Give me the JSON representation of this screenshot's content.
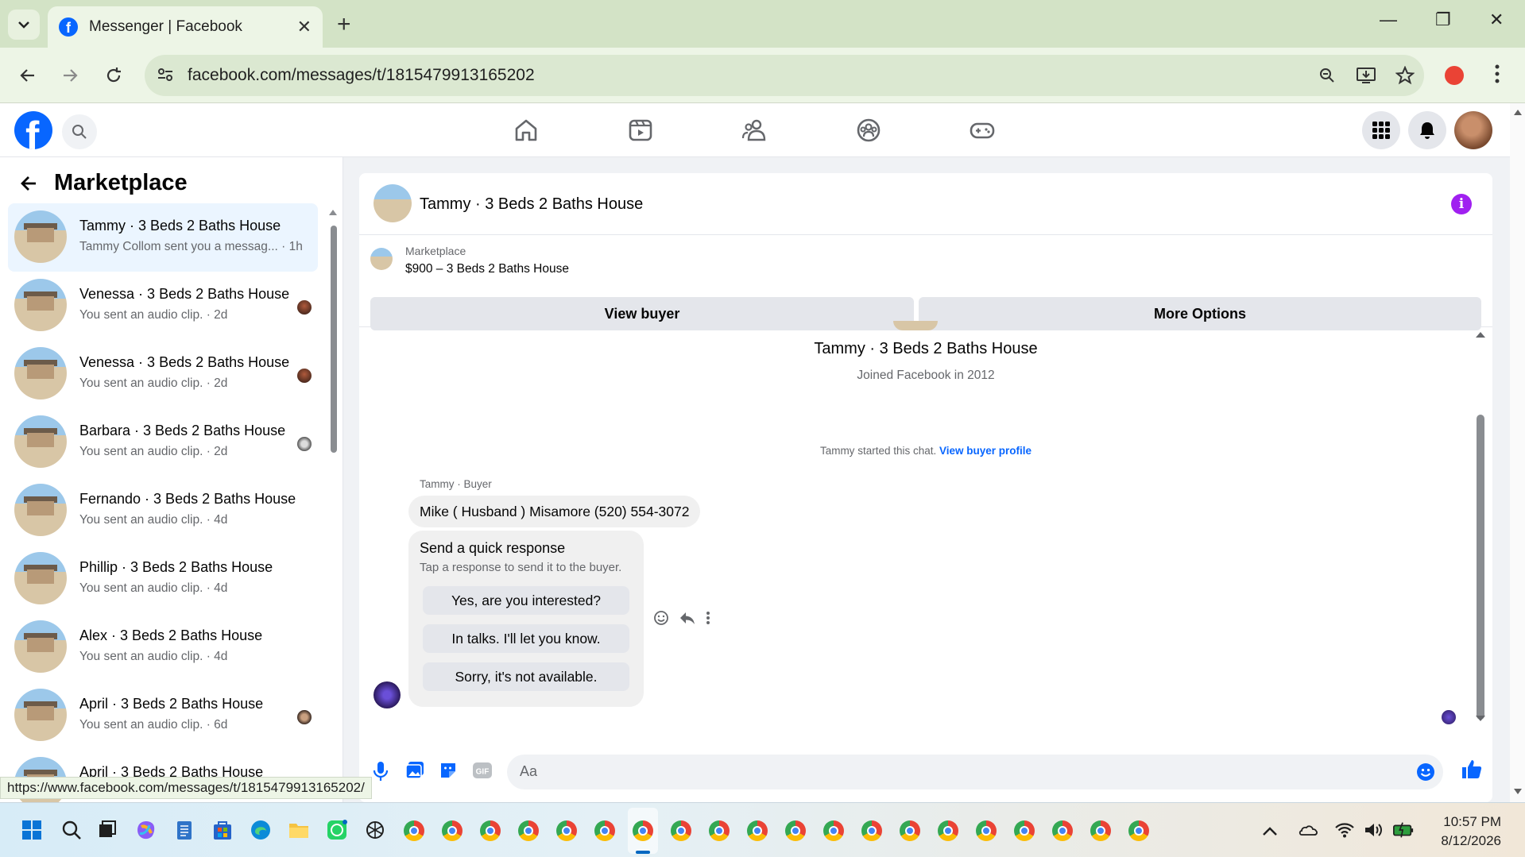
{
  "browser": {
    "tab_title": "Messenger | Facebook",
    "url": "facebook.com/messages/t/1815479913165202",
    "status_url": "https://www.facebook.com/messages/t/1815479913165202/"
  },
  "sidebar": {
    "title": "Marketplace",
    "conversations": [
      {
        "name": "Tammy · 3 Beds 2 Baths House",
        "preview": "Tammy Collom sent you a messag... · 1h",
        "active": true
      },
      {
        "name": "Venessa · 3 Beds 2 Baths House",
        "preview": "You sent an audio clip. · 2d"
      },
      {
        "name": "Venessa · 3 Beds 2 Baths House",
        "preview": "You sent an audio clip. · 2d"
      },
      {
        "name": "Barbara · 3 Beds 2 Baths House",
        "preview": "You sent an audio clip. · 2d"
      },
      {
        "name": "Fernando · 3 Beds 2 Baths House",
        "preview": "You sent an audio clip. · 4d"
      },
      {
        "name": "Phillip · 3 Beds 2 Baths House",
        "preview": "You sent an audio clip. · 4d"
      },
      {
        "name": "Alex · 3 Beds 2 Baths House",
        "preview": "You sent an audio clip. · 4d"
      },
      {
        "name": "April · 3 Beds 2 Baths House",
        "preview": "You sent an audio clip. · 6d"
      },
      {
        "name": "April · 3 Beds 2 Baths House",
        "preview": ""
      }
    ]
  },
  "chat": {
    "title": "Tammy · 3 Beds 2 Baths House",
    "marketplace_label": "Marketplace",
    "listing": "$900 – 3 Beds 2 Baths House",
    "view_buyer_label": "View buyer",
    "more_options_label": "More Options",
    "buyer_name": "Tammy · 3 Beds 2 Baths House",
    "joined": "Joined Facebook in 2012",
    "started_text": "Tammy started this chat.",
    "view_profile_link": "View buyer profile",
    "sender_label": "Tammy · Buyer",
    "message": "Mike ( Husband ) Misamore (520) 554-3072",
    "quick_title": "Send a quick response",
    "quick_subtitle": "Tap a response to send it to the buyer.",
    "quick_options": [
      "Yes, are you interested?",
      "In talks. I'll let you know.",
      "Sorry, it's not available."
    ],
    "composer_placeholder": "Aa"
  },
  "taskbar": {
    "time": "10:57 PM",
    "date": "8/12/2026"
  },
  "colors": {
    "facebook_blue": "#0866ff",
    "info_purple": "#a020f0",
    "browser_frame": "#d3e3c6"
  }
}
